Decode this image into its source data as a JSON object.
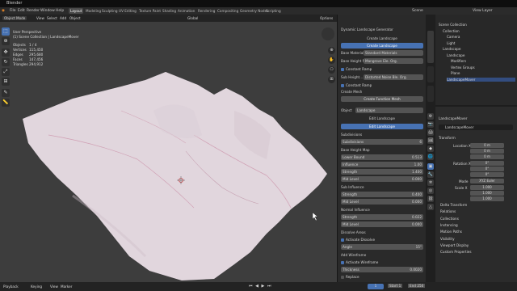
{
  "app_title": "Blender",
  "menus": [
    "File",
    "Edit",
    "Render",
    "Window",
    "Help"
  ],
  "workspaces": [
    "Layout",
    "Modeling",
    "Sculpting",
    "UV Editing",
    "Texture Paint",
    "Shading",
    "Animation",
    "Rendering",
    "Compositing",
    "Geometry Nodes",
    "Scripting"
  ],
  "active_workspace": "Layout",
  "scene": "Scene",
  "view_layer": "View Layer",
  "viewport": {
    "mode": "Object Mode",
    "menus": [
      "View",
      "Select",
      "Add",
      "Object"
    ],
    "orientation": "Global",
    "options": "Options",
    "perspective": "User Perspective",
    "collection": "(1) Scene Collection | LandscapeMover",
    "stats": [
      {
        "k": "Objects",
        "v": "1 / 4"
      },
      {
        "k": "Vertices",
        "v": "115,450"
      },
      {
        "k": "Edges",
        "v": "295,680"
      },
      {
        "k": "Faces",
        "v": "147,456"
      },
      {
        "k": "Triangles",
        "v": "294,912"
      }
    ]
  },
  "addon": {
    "title": "Dynamic Landscape Generator",
    "create_landscape": "Create Landscape",
    "create_landscape_btn": "Create Landscape",
    "base_material_label": "Base Material...",
    "base_material": "Standard Materials",
    "base_height_label": "Base Height Map...",
    "base_height": "Mangrove Ele. Org.",
    "constant_ramp": "Constant Ramp",
    "sub_height_label": "Sub Height...",
    "sub_height": "Distorted Noise Ble. Org.",
    "constant_ramp2": "Constant Ramp",
    "create_mesh": "Create Mesh",
    "create_function_mesh": "Create Function Mesh",
    "object_label": "Object",
    "object_value": "Landscape",
    "edit_landscape": "Edit Landscape",
    "edit_landscape_btn": "Edit Landscape",
    "subdivisions_hdr": "Subdivisions",
    "subdivisions_label": "Subdivisions",
    "subdivisions": "6",
    "base_height_map": "Base Height Map",
    "lower_bound_label": "Lower Bound",
    "lower_bound": "0.513",
    "influence_label": "Influence",
    "influence": "1.00",
    "strength_label": "Strength",
    "strength": "1.400",
    "midlevel_label": "Mid Level",
    "midlevel": "0.000",
    "subinfluence_hdr": "Sub Influence",
    "strength2_label": "Strength",
    "strength2": "0.400",
    "midlevel2_label": "Mid Level",
    "midlevel2": "0.000",
    "normal_influence": "Normal Influence",
    "strength3_label": "Strength",
    "strength3": "0.022",
    "midlevel3_label": "Mid Level",
    "midlevel3": "0.000",
    "dissolve_areas": "Dissolve Areas",
    "activate_dissolve": "Activate Dissolve",
    "angle_label": "Angle",
    "angle": "15°",
    "add_wireframe": "Add Wireframe",
    "activate_wireframe": "Activate Wireframe",
    "thickness_label": "Thickness",
    "thickness": "0.0020",
    "replace": "Replace"
  },
  "outliner": [
    {
      "label": "Scene Collection",
      "indent": 0
    },
    {
      "label": "Collection",
      "indent": 1
    },
    {
      "label": "Camera",
      "indent": 2
    },
    {
      "label": "Light",
      "indent": 2
    },
    {
      "label": "Landscape",
      "indent": 1
    },
    {
      "label": "Landscape",
      "indent": 2
    },
    {
      "label": "Modifiers",
      "indent": 3
    },
    {
      "label": "Vertex Groups",
      "indent": 3
    },
    {
      "label": "Plane",
      "indent": 3
    },
    {
      "label": "LandscapeMover",
      "indent": 2,
      "selected": true
    }
  ],
  "properties": {
    "object": "LandscapeMover",
    "object_field": "LandscapeMover",
    "transform": "Transform",
    "location_label": "Location X",
    "loc": [
      "0 m",
      "0 m",
      "0 m"
    ],
    "rotation_label": "Rotation X",
    "rot": [
      "0°",
      "0°",
      "0°"
    ],
    "mode_label": "Mode",
    "mode": "XYZ Euler",
    "scale_label": "Scale X",
    "scale": [
      "1.000",
      "1.000",
      "1.000"
    ],
    "sections": [
      "Delta Transform",
      "Relations",
      "Collections",
      "Instancing",
      "Motion Paths",
      "Visibility",
      "Viewport Display",
      "Custom Properties"
    ]
  },
  "statusbar": {
    "items": [
      "Playback",
      "Keying",
      "View",
      "Marker"
    ],
    "frame": "1",
    "start_label": "Start",
    "start": "1",
    "end_label": "End",
    "end": "250"
  },
  "colors": {
    "accent": "#4772b3",
    "viewport_bg": "#3d3d3d",
    "mesh": "#e9dfe6",
    "selected_row": "#334d80"
  }
}
